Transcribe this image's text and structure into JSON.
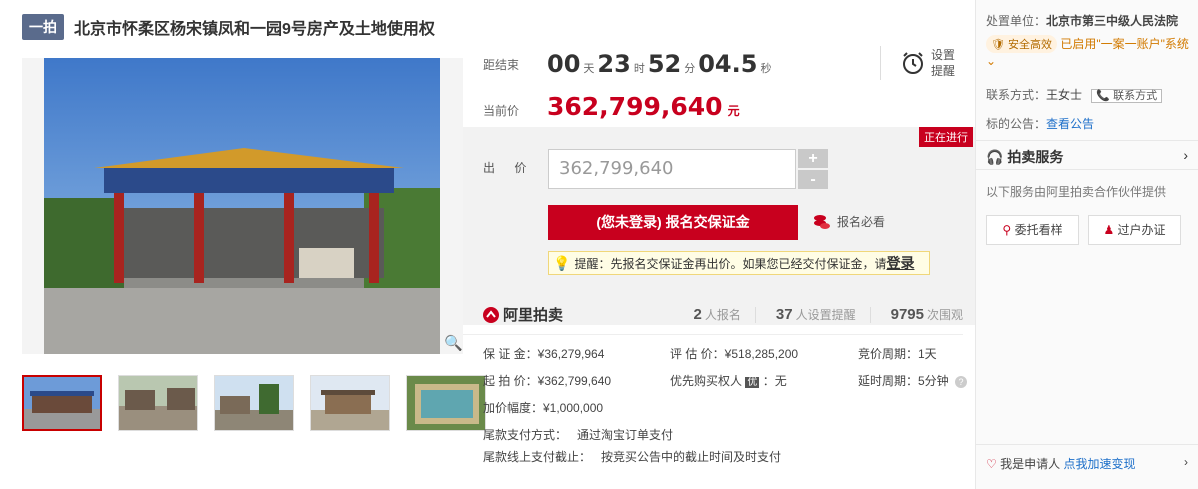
{
  "header": {
    "tag": "一拍",
    "title": "北京市怀柔区杨宋镇凤和一园9号房产及土地使用权"
  },
  "timer": {
    "label": "距结束",
    "days": "00",
    "days_unit": "天",
    "hours": "23",
    "hours_unit": "时",
    "minutes": "52",
    "minutes_unit": "分",
    "seconds": "04.5",
    "seconds_unit": "秒"
  },
  "alarm": {
    "line1": "设置",
    "line2": "提醒"
  },
  "current_price": {
    "label": "当前价",
    "value": "362,799,640",
    "unit": "元"
  },
  "status": "正在进行",
  "bid": {
    "label": "出 价",
    "input_value": "362,799,640",
    "plus": "+",
    "minus": "-",
    "register_button": "(您未登录) 报名交保证金",
    "must_read": "报名必看",
    "tip_text": "提醒：先报名交保证金再出价。如果您已经交付保证金，请",
    "tip_link": "登录"
  },
  "ali": {
    "logo": "阿里拍卖",
    "signups": "2",
    "signups_label": "人报名",
    "reminders": "37",
    "reminders_label": "人设置提醒",
    "views": "9795",
    "views_label": "次围观"
  },
  "info": {
    "deposit": "保 证 金：¥36,279,964",
    "appraisal": "评 估 价：¥518,285,200",
    "period": "竞价周期：1天",
    "start_price": "起 拍 价：¥362,799,640",
    "priority_label": "优先购买权人",
    "priority_badge": "优",
    "priority_value": "：无",
    "extend": "延时周期：5分钟",
    "increment": "加价幅度：¥1,000,000",
    "final_pay_label": "尾款支付方式：",
    "final_pay_value": "通过淘宝订单支付",
    "deadline_label": "尾款线上支付截止：",
    "deadline_value": "按竞买公告中的截止时间及时支付"
  },
  "right": {
    "court_label": "处置单位：",
    "court": "北京市第三中级人民法院",
    "safe_badge": "安全高效",
    "safe_text": "已启用\"一案一账户\"系统",
    "contact_label": "联系方式：",
    "contact_name": "王女士",
    "contact_button": "联系方式",
    "notice_label": "标的公告：",
    "notice_link": "查看公告",
    "service_title": "拍卖服务",
    "service_desc": "以下服务由阿里拍卖合作伙伴提供",
    "svc1": "委托看样",
    "svc2": "过户办证",
    "applicant": "我是申请人",
    "applicant_link": "点我加速变现"
  },
  "colors": {
    "accent": "#c8001e",
    "link": "#1d6fc9",
    "tag": "#5a6b8c"
  }
}
